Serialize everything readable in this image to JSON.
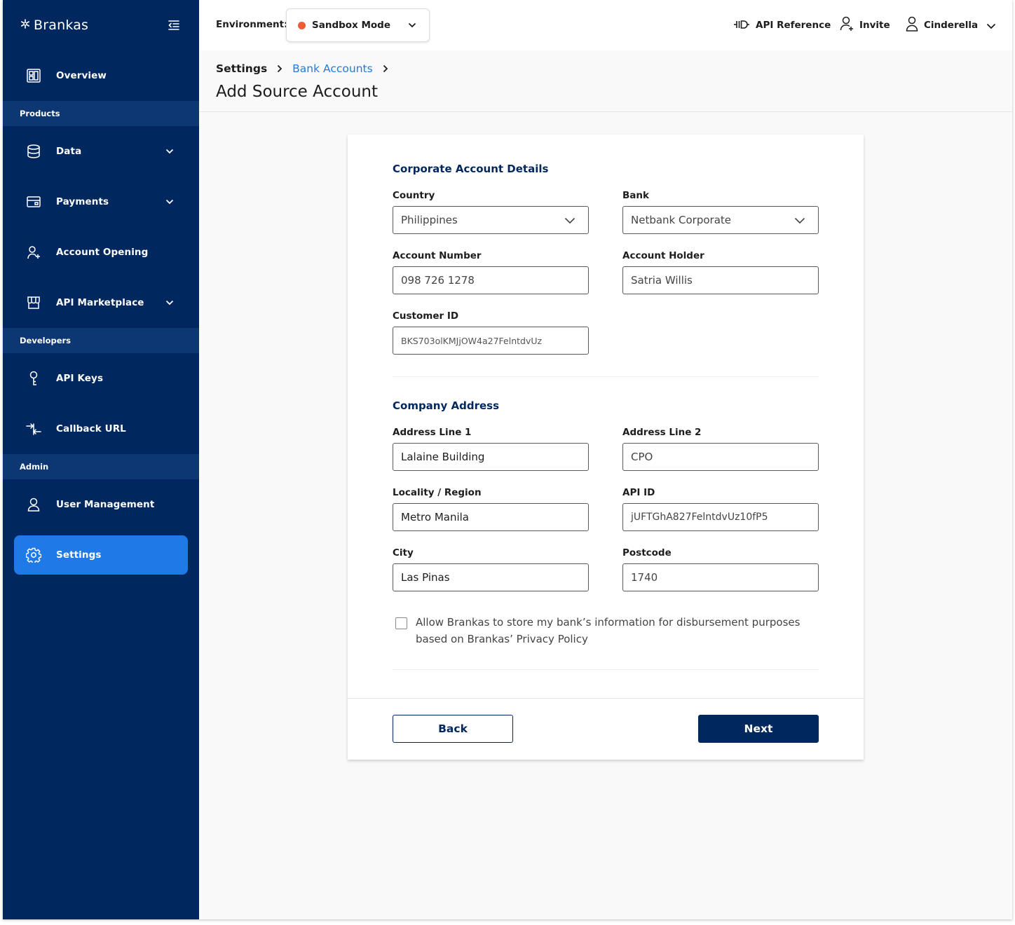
{
  "app": {
    "brand": "Brankas"
  },
  "sidebar": {
    "overview": "Overview",
    "sections": {
      "products": "Products",
      "developers": "Developers",
      "admin": "Admin"
    },
    "items": {
      "data": "Data",
      "payments": "Payments",
      "account_opening": "Account Opening",
      "api_marketplace": "API Marketplace",
      "api_keys": "API Keys",
      "callback_url": "Callback URL",
      "user_management": "User Management",
      "settings": "Settings"
    },
    "active": "settings"
  },
  "topbar": {
    "environment_label": "Environment:",
    "environment_value": "Sandbox Mode",
    "environment_status_color": "#ef5c35",
    "api_reference": "API Reference",
    "invite": "Invite",
    "user_name": "Cinderella"
  },
  "breadcrumb": {
    "root": "Settings",
    "current": "Bank Accounts"
  },
  "page_title": "Add Source Account",
  "form": {
    "corporate_section_title": "Corporate Account Details",
    "country": {
      "label": "Country",
      "value": "Philippines"
    },
    "bank": {
      "label": "Bank",
      "value": "Netbank Corporate"
    },
    "account_number": {
      "label": "Account Number",
      "value": "098 726 1278"
    },
    "account_holder": {
      "label": "Account Holder",
      "value": "Satria Willis"
    },
    "customer_id": {
      "label": "Customer ID",
      "value": "BKS703olKMJjOW4a27FelntdvUz"
    },
    "address_section_title": "Company Address",
    "address_line_1": {
      "label": "Address Line 1",
      "value": "Lalaine Building"
    },
    "address_line_2": {
      "label": "Address Line 2",
      "value": "CPO"
    },
    "locality": {
      "label": "Locality / Region",
      "value": "Metro Manila"
    },
    "api_id": {
      "label": "API ID",
      "value": "jUFTGhA827FelntdvUz10fP5"
    },
    "city": {
      "label": "City",
      "value": "Las Pinas"
    },
    "postcode": {
      "label": "Postcode",
      "value": "1740"
    },
    "consent_text": "Allow Brankas to store my bank’s information for disbursement purposes based on Brankas’ Privacy Policy",
    "consent_checked": false,
    "back_label": "Back",
    "next_label": "Next"
  },
  "colors": {
    "navy": "#01275f",
    "accent": "#1f7ae8",
    "section_header": "#0d3772"
  }
}
